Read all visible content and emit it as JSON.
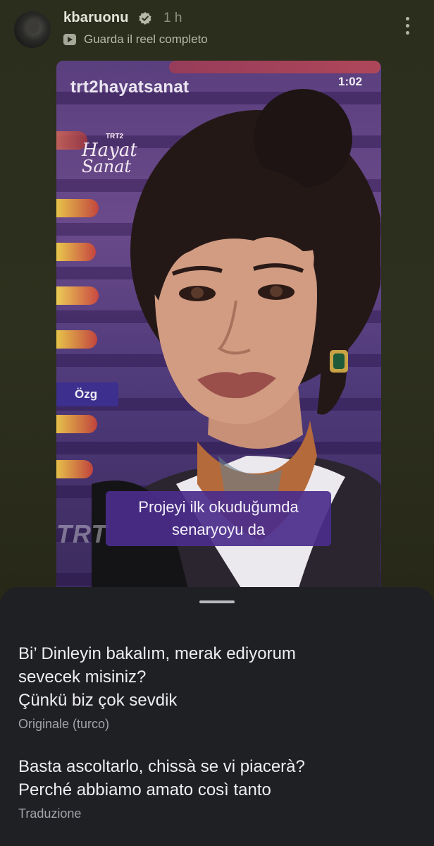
{
  "post": {
    "username": "kbaruonu",
    "time": "1 h",
    "reel_link": "Guarda il reel completo"
  },
  "video": {
    "title": "trt2hayatsanat",
    "duration": "1:02",
    "logo": {
      "top": "TRT2",
      "line1": "Hayat",
      "line2": "Sanat"
    },
    "name_tag": "Özg",
    "subtitle_line1": "Projeyi ilk okuduğumda",
    "subtitle_line2": "senaryoyu da",
    "mic_text": "TRT"
  },
  "sheet": {
    "original_line1": "Bi’ Dinleyin bakalım, merak ediyorum",
    "original_line2": "sevecek misiniz?",
    "original_line3": "Çünkü biz çok sevdik",
    "original_label": "Originale (turco)",
    "translation_line1": "Basta ascoltarlo, chissà se vi piacerà?",
    "translation_line2": "Perché abbiamo amato così tanto",
    "translation_label": "Traduzione"
  },
  "colors": {
    "background": "#2b2d1d",
    "sheet": "#1f2024",
    "subtitle_bg": "#4b2d8c",
    "name_tag_bg": "#3d2f8e"
  }
}
